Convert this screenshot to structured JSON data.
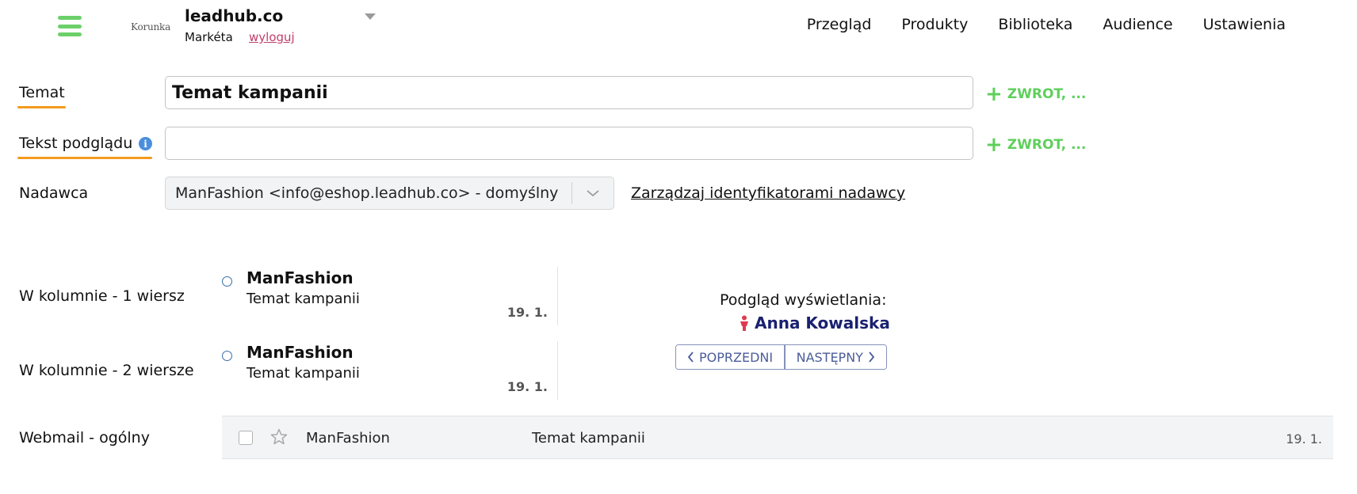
{
  "header": {
    "logo_text": "Korunka",
    "account_name": "leadhub.co",
    "user_name": "Markéta",
    "logout_label": "wyloguj",
    "nav": [
      "Przegląd",
      "Produkty",
      "Biblioteka",
      "Audience",
      "Ustawienia"
    ]
  },
  "form": {
    "subject_label": "Temat",
    "subject_value": "Temat kampanii",
    "preview_label": "Tekst podglądu",
    "preview_value": "",
    "add_variable_label": "ZWROT, ...",
    "sender_label": "Nadawca",
    "sender_value": "ManFashion <info@eshop.leadhub.co> - domyślny",
    "manage_senders_label": "Zarządzaj identyfikatorami nadawcy"
  },
  "previews": {
    "column_1_label": "W kolumnie - 1 wiersz",
    "column_2_label": "W kolumnie - 2 wiersze",
    "webmail_label": "Webmail - ogólny",
    "sender": "ManFashion",
    "subject": "Temat kampanii",
    "date": "19. 1.",
    "display_preview_label": "Podgląd wyświetlania:",
    "contact_name": "Anna Kowalska",
    "prev_label": "POPRZEDNI",
    "next_label": "NASTĘPNY"
  },
  "colors": {
    "accent_green": "#5fcf5c",
    "underline_orange": "#f39a1e",
    "link_pink": "#c0406a",
    "contact_navy": "#1a2170",
    "pager_blue": "#4b5d9a"
  }
}
